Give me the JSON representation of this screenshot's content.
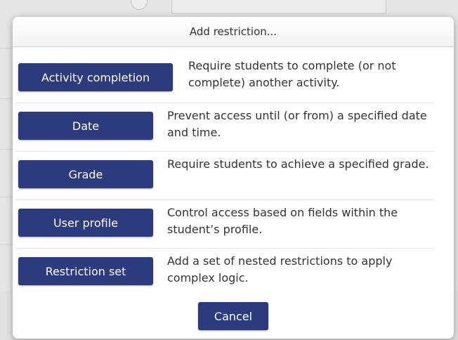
{
  "dialog": {
    "title": "Add restriction...",
    "cancel_label": "Cancel"
  },
  "options": [
    {
      "button_label": "Activity completion",
      "description": "Require students to complete (or not complete) another activity."
    },
    {
      "button_label": "Date",
      "description": "Prevent access until (or from) a specified date and time."
    },
    {
      "button_label": "Grade",
      "description": "Require students to achieve a specified grade."
    },
    {
      "button_label": "User profile",
      "description": "Control access based on fields within the student’s profile."
    },
    {
      "button_label": "Restriction set",
      "description": "Add a set of nested restrictions to apply complex logic."
    }
  ],
  "colors": {
    "button_bg": "#2c3b7d",
    "button_text": "#ffffff"
  }
}
